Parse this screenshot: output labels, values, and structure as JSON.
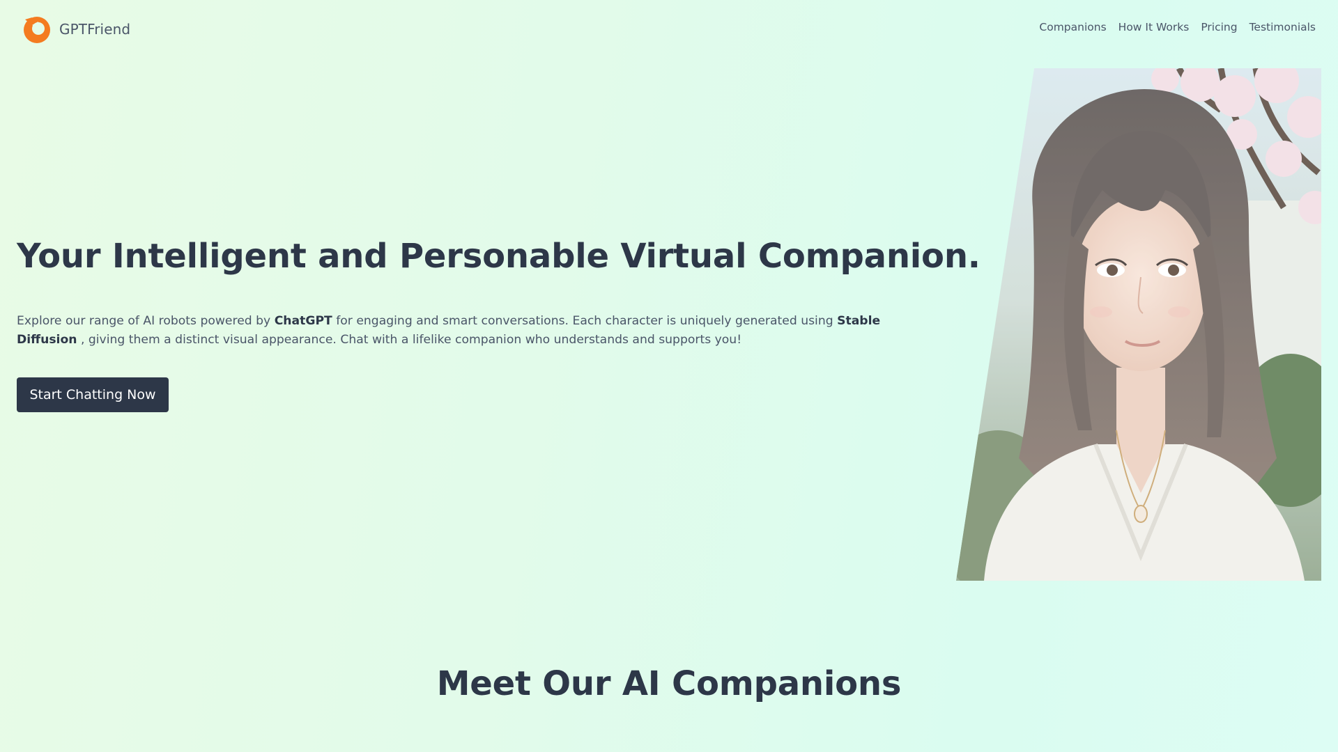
{
  "brand": {
    "name": "GPTFriend",
    "accent_color": "#f47b20",
    "logo_icon": "flame-ring-icon"
  },
  "nav": {
    "items": [
      {
        "label": "Companions"
      },
      {
        "label": "How It Works"
      },
      {
        "label": "Pricing"
      },
      {
        "label": "Testimonials"
      }
    ]
  },
  "hero": {
    "title": "Your Intelligent and Personable Virtual Companion.",
    "description": {
      "part1": "Explore our range of AI robots powered by ",
      "bold1": "ChatGPT",
      "part2": " for engaging and smart conversations. Each character is uniquely generated using ",
      "bold2": "Stable Diffusion",
      "part3": " , giving them a distinct visual appearance. Chat with a lifelike companion who understands and supports you!"
    },
    "cta_label": "Start Chatting Now",
    "image_icon": "companion-portrait-image"
  },
  "companions_section": {
    "title": "Meet Our AI Companions"
  },
  "colors": {
    "text_dark": "#2d3748",
    "text_muted": "#4a5568",
    "button_bg": "#2d3748"
  }
}
